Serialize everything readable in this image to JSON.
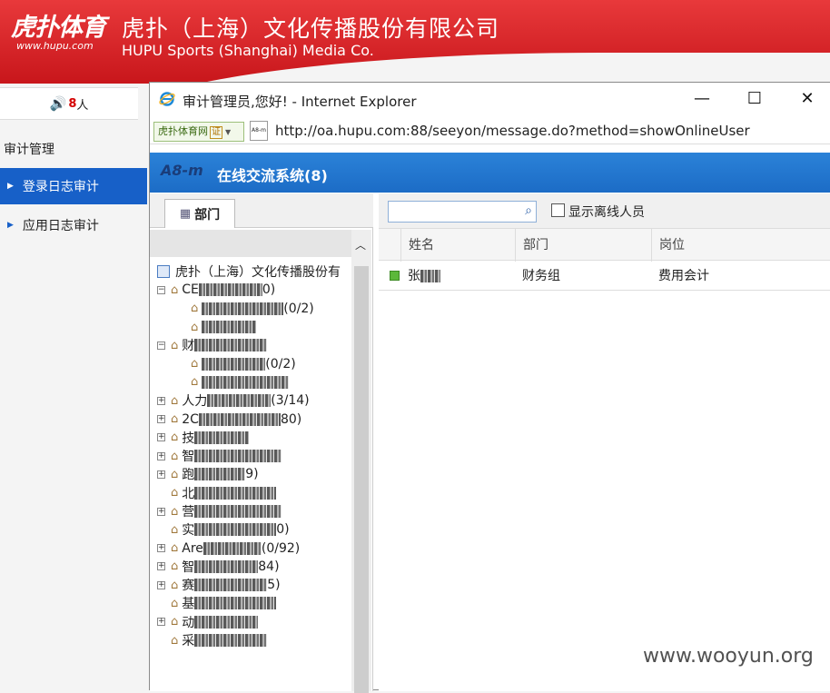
{
  "header": {
    "logo_text": "虎扑体育",
    "logo_url": "www.hupu.com",
    "company_cn": "虎扑（上海）文化传播股份有限公司",
    "company_en": "HUPU Sports (Shanghai) Media Co."
  },
  "sidebar": {
    "online_count": "8",
    "online_unit": "人",
    "section_title": "审计管理",
    "items": [
      {
        "label": "登录日志审计",
        "active": true
      },
      {
        "label": "应用日志审计",
        "active": false
      }
    ]
  },
  "browser": {
    "title": "审计管理员,您好! - Internet Explorer",
    "favorite_label": "虎扑体育网",
    "favorite_badge": "证",
    "page_icon_text": "A8-m",
    "url": "http://oa.hupu.com:88/seeyon/message.do?method=showOnlineUser",
    "btn_minimize": "—",
    "btn_maximize": "☐",
    "btn_close": "✕"
  },
  "app": {
    "logo": "A8-m",
    "title": "在线交流系统(8)"
  },
  "dept_panel": {
    "tab_label": "部门",
    "root": "虎扑（上海）文化传播股份有",
    "nodes": [
      {
        "prefix": "CE",
        "suffix": "0)",
        "expander": "minus",
        "indent": 1
      },
      {
        "prefix": "",
        "suffix": "(0/2)",
        "expander": "none",
        "indent": 2
      },
      {
        "prefix": "",
        "suffix": "",
        "expander": "none",
        "indent": 2
      },
      {
        "prefix": "财",
        "suffix": "",
        "expander": "minus",
        "indent": 1
      },
      {
        "prefix": "",
        "suffix": "(0/2)",
        "expander": "none",
        "indent": 2
      },
      {
        "prefix": "",
        "suffix": "",
        "expander": "none",
        "indent": 2
      },
      {
        "prefix": "人力",
        "suffix": "(3/14)",
        "expander": "plus",
        "indent": 1
      },
      {
        "prefix": "2C",
        "suffix": "80)",
        "expander": "plus",
        "indent": 1
      },
      {
        "prefix": "技",
        "suffix": "",
        "expander": "plus",
        "indent": 1
      },
      {
        "prefix": "智",
        "suffix": "",
        "expander": "plus",
        "indent": 1
      },
      {
        "prefix": "跑",
        "suffix": "9)",
        "expander": "plus",
        "indent": 1
      },
      {
        "prefix": "北",
        "suffix": "",
        "expander": "none",
        "indent": 1
      },
      {
        "prefix": "营",
        "suffix": "",
        "expander": "plus",
        "indent": 1
      },
      {
        "prefix": "实",
        "suffix": "0)",
        "expander": "none",
        "indent": 1
      },
      {
        "prefix": "Are",
        "suffix": "(0/92)",
        "expander": "plus",
        "indent": 1
      },
      {
        "prefix": "智",
        "suffix": "84)",
        "expander": "plus",
        "indent": 1
      },
      {
        "prefix": "赛",
        "suffix": "5)",
        "expander": "plus",
        "indent": 1
      },
      {
        "prefix": "基",
        "suffix": "",
        "expander": "none",
        "indent": 1
      },
      {
        "prefix": "动",
        "suffix": "",
        "expander": "plus",
        "indent": 1
      },
      {
        "prefix": "采",
        "suffix": "",
        "expander": "none",
        "indent": 1
      }
    ]
  },
  "users_panel": {
    "search_placeholder": "",
    "show_offline_label": "显示离线人员",
    "columns": [
      "姓名",
      "部门",
      "岗位"
    ],
    "rows": [
      {
        "name": "张",
        "dept": "财务组",
        "post": "费用会计",
        "online": true
      }
    ]
  },
  "watermark": "www.wooyun.org",
  "colors": {
    "brand_red": "#d0161c",
    "active_blue": "#1760c8",
    "header_blue": "#2478d2",
    "online_green": "#5cb83a"
  }
}
